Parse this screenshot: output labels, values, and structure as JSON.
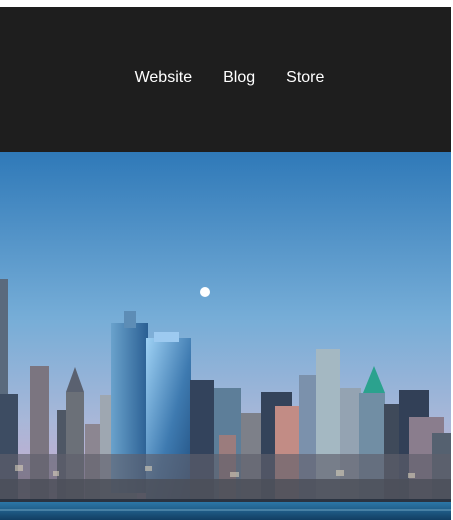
{
  "nav": {
    "items": [
      {
        "label": "Website"
      },
      {
        "label": "Blog"
      },
      {
        "label": "Store"
      }
    ]
  },
  "colors": {
    "header_bg": "#1e1e1e",
    "nav_text": "#ffffff",
    "sky_top": "#2f79b8",
    "sky_mid": "#7fb0d8",
    "sky_bottom": "#c5a6c8",
    "water": "#1f5e8c"
  },
  "hero": {
    "image_name": "city-skyline-hero-image"
  }
}
